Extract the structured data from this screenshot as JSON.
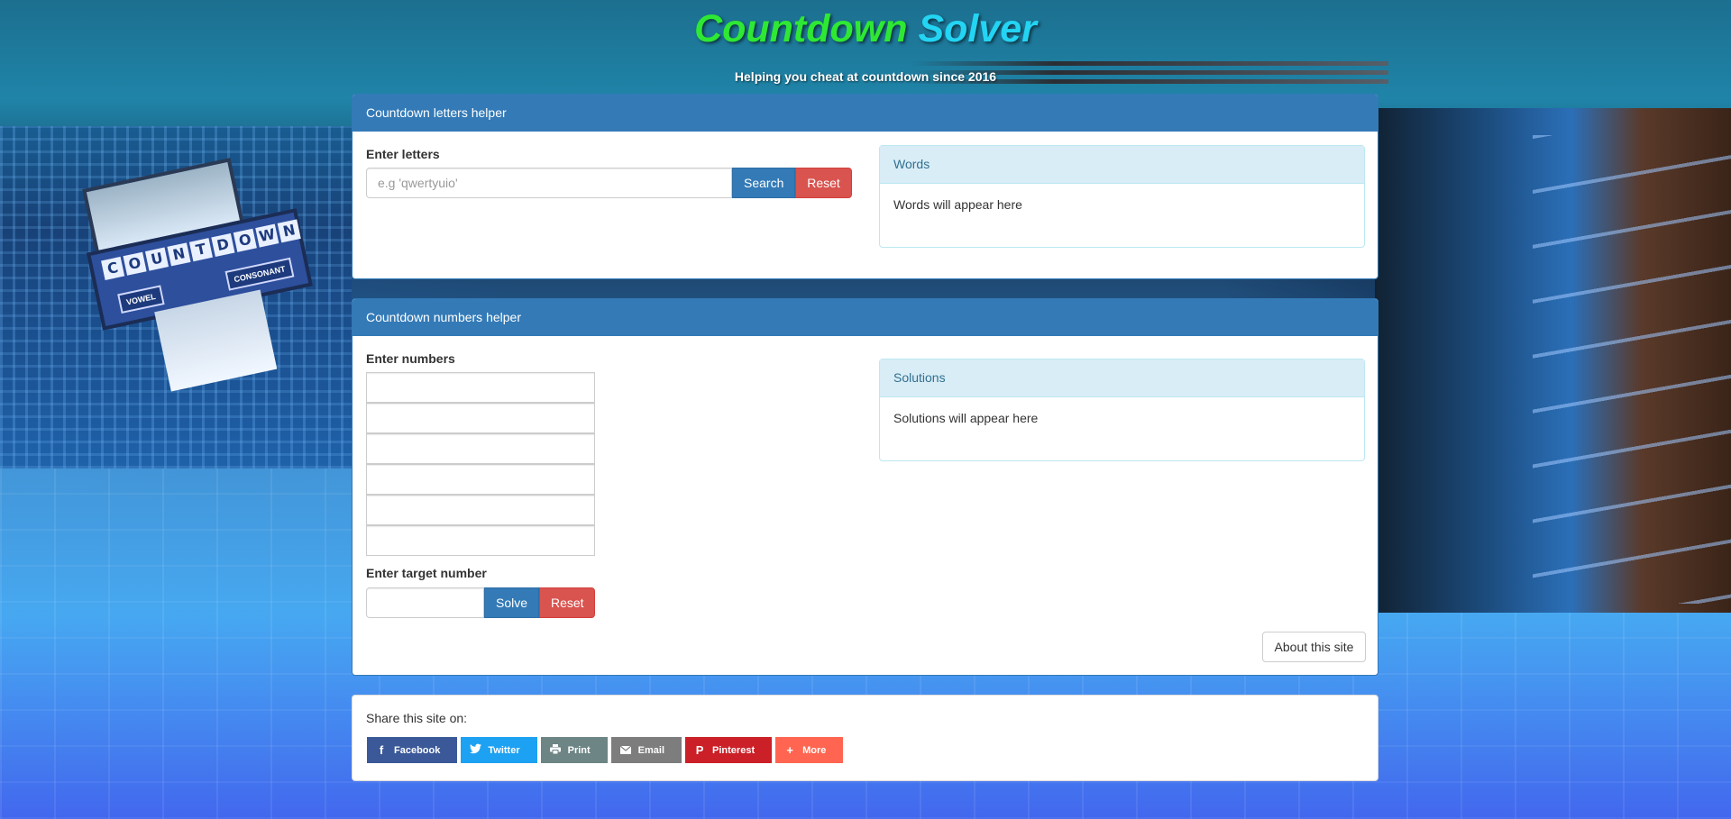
{
  "header": {
    "title_part1": "Countdown",
    "title_part2": "Solver",
    "tagline": "Helping you cheat at countdown since 2016"
  },
  "background": {
    "podium_word": [
      "C",
      "O",
      "U",
      "N",
      "T",
      "D",
      "O",
      "W",
      "N"
    ],
    "vowel_label": "VOWEL",
    "consonant_label": "CONSONANT"
  },
  "letters": {
    "heading": "Countdown letters helper",
    "label": "Enter letters",
    "placeholder": "e.g 'qwertyuio'",
    "search_label": "Search",
    "reset_label": "Reset",
    "words_heading": "Words",
    "words_body": "Words will appear here"
  },
  "numbers": {
    "heading": "Countdown numbers helper",
    "label": "Enter numbers",
    "inputs": [
      "",
      "",
      "",
      "",
      "",
      ""
    ],
    "target_label": "Enter target number",
    "solve_label": "Solve",
    "reset_label": "Reset",
    "solutions_heading": "Solutions",
    "solutions_body": "Solutions will appear here",
    "about_label": "About this site"
  },
  "share": {
    "text": "Share this site on:",
    "buttons": [
      {
        "label": "Facebook",
        "icon": "facebook-icon",
        "color": "#3b5998"
      },
      {
        "label": "Twitter",
        "icon": "twitter-icon",
        "color": "#1da1f2"
      },
      {
        "label": "Print",
        "icon": "print-icon",
        "color": "#6d8584"
      },
      {
        "label": "Email",
        "icon": "email-icon",
        "color": "#7d7d7d"
      },
      {
        "label": "Pinterest",
        "icon": "pinterest-icon",
        "color": "#cb2027"
      },
      {
        "label": "More",
        "icon": "plus-icon",
        "color": "#ff6550"
      }
    ]
  },
  "colors": {
    "primary": "#337ab7",
    "danger": "#d9534f",
    "title_green": "#2ee834",
    "title_cyan": "#23d4f3"
  }
}
